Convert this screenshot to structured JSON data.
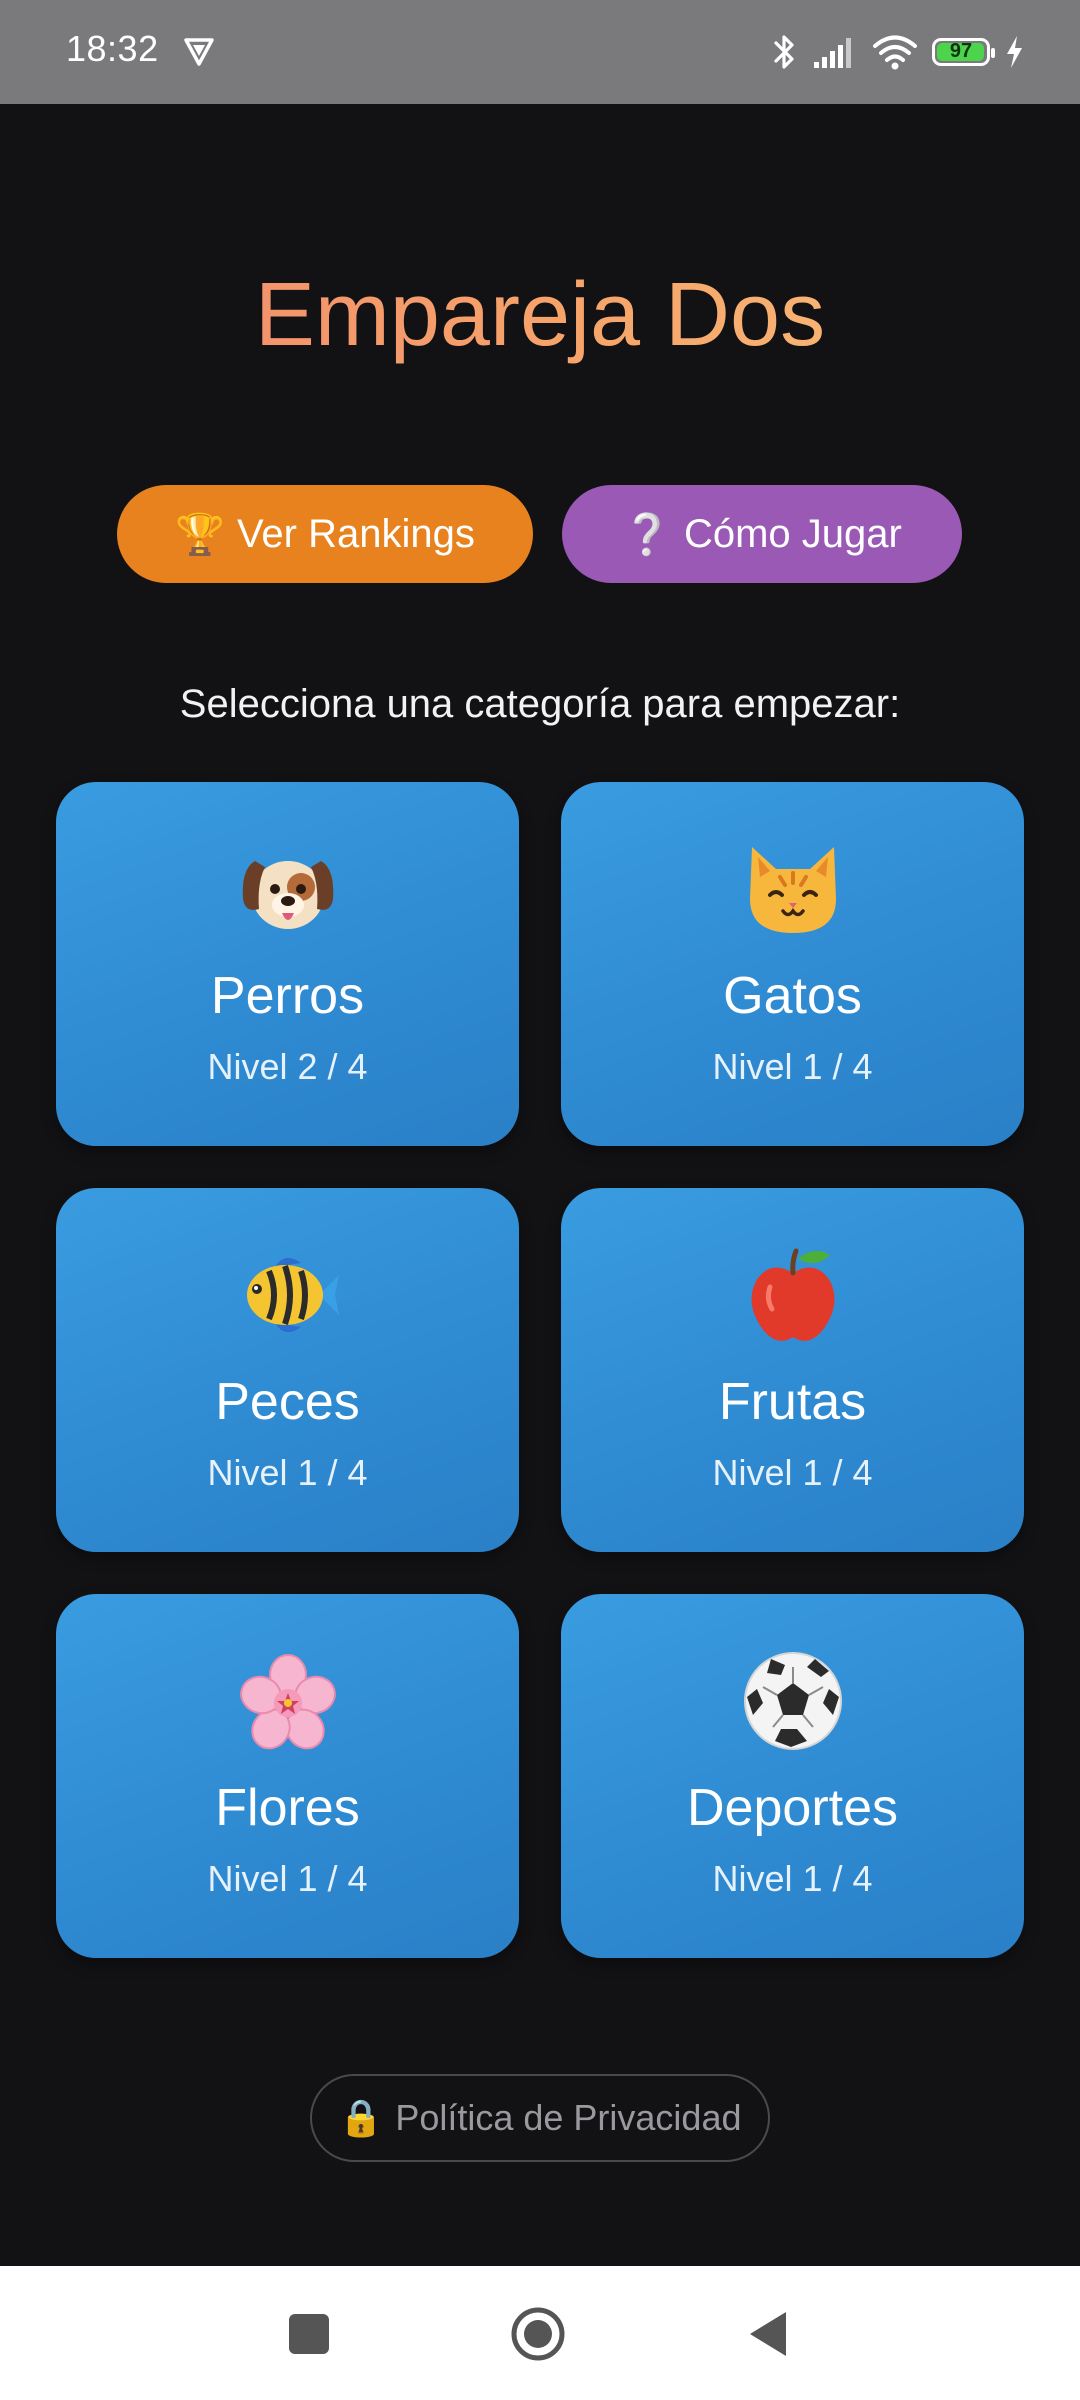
{
  "status_bar": {
    "time": "18:32",
    "battery_level": "97",
    "battery_fraction": 0.97
  },
  "app": {
    "title": "Empareja Dos",
    "rankings_button": {
      "icon": "🏆",
      "label": "Ver Rankings"
    },
    "howto_button": {
      "icon": "❔",
      "label": "Cómo Jugar"
    },
    "subtitle": "Selecciona una categoría para empezar:",
    "categories": [
      {
        "name": "Perros",
        "level": "Nivel 2 / 4",
        "icon": "dog-face-icon"
      },
      {
        "name": "Gatos",
        "level": "Nivel 1 / 4",
        "icon": "cat-face-icon"
      },
      {
        "name": "Peces",
        "level": "Nivel 1 / 4",
        "icon": "tropical-fish-icon"
      },
      {
        "name": "Frutas",
        "level": "Nivel 1 / 4",
        "icon": "red-apple-icon"
      },
      {
        "name": "Flores",
        "level": "Nivel 1 / 4",
        "icon": "cherry-blossom-icon"
      },
      {
        "name": "Deportes",
        "level": "Nivel 1 / 4",
        "icon": "soccer-ball-icon"
      }
    ],
    "privacy_button": {
      "icon": "🔒",
      "label": "Política de Privacidad"
    }
  },
  "colors": {
    "background": "#121114",
    "rankings": "#e8821e",
    "howto": "#9b59b6",
    "card": "#3196da",
    "title_gradient_start": "#f1876d",
    "title_gradient_end": "#f9c27c"
  }
}
